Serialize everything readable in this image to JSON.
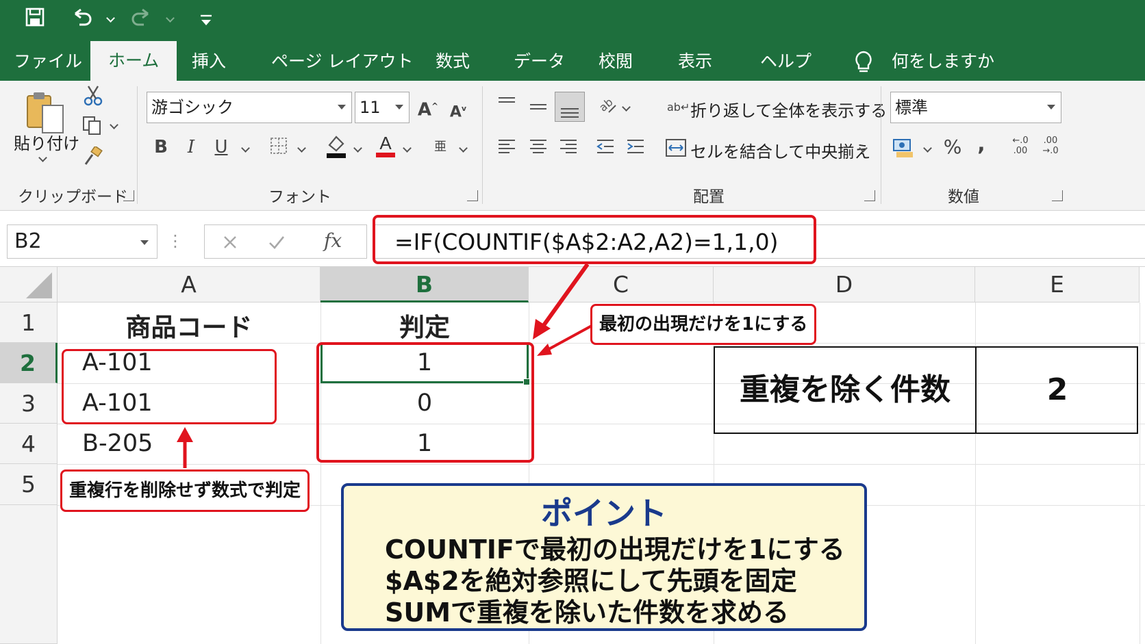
{
  "quick_access": {
    "save_icon": "save-icon",
    "undo_icon": "undo-icon",
    "redo_icon": "redo-icon",
    "customize_icon": "customize-icon"
  },
  "tabs": [
    {
      "label": "ファイル"
    },
    {
      "label": "ホーム"
    },
    {
      "label": "挿入"
    },
    {
      "label": "ページ レイアウト"
    },
    {
      "label": "数式"
    },
    {
      "label": "データ"
    },
    {
      "label": "校閲"
    },
    {
      "label": "表示"
    },
    {
      "label": "ヘルプ"
    }
  ],
  "tell_me": "何をしますか",
  "ribbon": {
    "clipboard": {
      "paste_label": "貼り付け",
      "group_label": "クリップボード"
    },
    "font": {
      "font_name": "游ゴシック",
      "font_size": "11",
      "group_label": "フォント"
    },
    "alignment": {
      "wrap_text": "折り返して全体を表示する",
      "merge_center": "セルを結合して中央揃え",
      "group_label": "配置"
    },
    "number": {
      "format": "標準",
      "group_label": "数値",
      "percent": "%",
      "comma": ","
    }
  },
  "formula_bar": {
    "name_box": "B2",
    "fx": "fx",
    "formula": "=IF(COUNTIF($A$2:A2,A2)=1,1,0)"
  },
  "columns": [
    "A",
    "B",
    "C",
    "D",
    "E"
  ],
  "rows": [
    "1",
    "2",
    "3",
    "4",
    "5"
  ],
  "cells": {
    "A1": "商品コード",
    "B1": "判定",
    "A2": "A-101",
    "A3": "A-101",
    "A4": "B-205",
    "B2": "1",
    "B3": "0",
    "B4": "1"
  },
  "callouts": {
    "first_occurrence": "最初の出現だけを1にする",
    "no_delete": "重複行を削除せず数式で判定"
  },
  "result": {
    "label": "重複を除く件数",
    "value": "2"
  },
  "point": {
    "title": "ポイント",
    "lines": [
      "COUNTIFで最初の出現だけを1にする",
      "$A$2を絶対参照にして先頭を固定",
      "SUMで重複を除いた件数を求める"
    ]
  },
  "colors": {
    "excel_green": "#1e6f3d",
    "highlight_red": "#e0141e",
    "point_blue": "#1a3a8c",
    "point_bg": "#fdf8d6"
  }
}
